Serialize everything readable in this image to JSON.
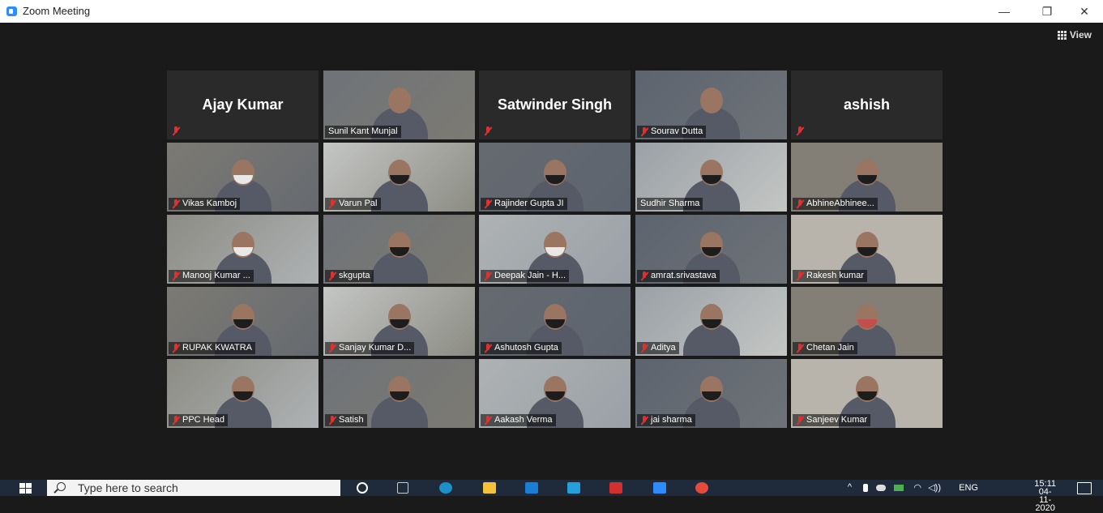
{
  "window": {
    "title": "Zoom Meeting",
    "minimize": "—",
    "restore": "❐",
    "close": "✕"
  },
  "view_button": {
    "label": "View"
  },
  "tiles": [
    {
      "name": "Ajay Kumar",
      "mode": "name"
    },
    {
      "name": "Sunil Kant Munjal",
      "mode": "video",
      "muted": false,
      "active": true
    },
    {
      "name": "Satwinder Singh",
      "mode": "name"
    },
    {
      "name": "Sourav Dutta",
      "mode": "video",
      "muted": true
    },
    {
      "name": "ashish",
      "mode": "name"
    },
    {
      "name": "Vikas Kamboj",
      "mode": "video",
      "muted": true
    },
    {
      "name": "Varun Pal",
      "mode": "video",
      "muted": true
    },
    {
      "name": "Rajinder Gupta JI",
      "mode": "video",
      "muted": true
    },
    {
      "name": "Sudhir Sharma",
      "mode": "video",
      "muted": false
    },
    {
      "name": "AbhineAbhinee...",
      "mode": "video",
      "muted": true
    },
    {
      "name": "Manooj Kumar ...",
      "mode": "video",
      "muted": true
    },
    {
      "name": "skgupta",
      "mode": "video",
      "muted": true
    },
    {
      "name": "Deepak Jain - H...",
      "mode": "video",
      "muted": true
    },
    {
      "name": "amrat.srivastava",
      "mode": "video",
      "muted": true
    },
    {
      "name": "Rakesh kumar",
      "mode": "video",
      "muted": true
    },
    {
      "name": "RUPAK KWATRA",
      "mode": "video",
      "muted": true
    },
    {
      "name": "Sanjay Kumar D...",
      "mode": "video",
      "muted": true
    },
    {
      "name": "Ashutosh Gupta",
      "mode": "video",
      "muted": true
    },
    {
      "name": "Aditya",
      "mode": "video",
      "muted": true
    },
    {
      "name": "Chetan Jain",
      "mode": "video",
      "muted": true
    },
    {
      "name": "PPC Head",
      "mode": "video",
      "muted": true
    },
    {
      "name": "Satish",
      "mode": "video",
      "muted": true
    },
    {
      "name": "Aakash Verma",
      "mode": "video",
      "muted": true
    },
    {
      "name": "jai sharma",
      "mode": "video",
      "muted": true
    },
    {
      "name": "Sanjeev Kumar",
      "mode": "video",
      "muted": true
    }
  ],
  "taskbar": {
    "search_placeholder": "Type here to search",
    "language": "ENG",
    "time": "15:11",
    "date": "04-11-2020"
  },
  "colors": {
    "active_speaker": "#c8dc4d",
    "muted_mic": "#e03030",
    "zoom_blue": "#2d8cff"
  }
}
